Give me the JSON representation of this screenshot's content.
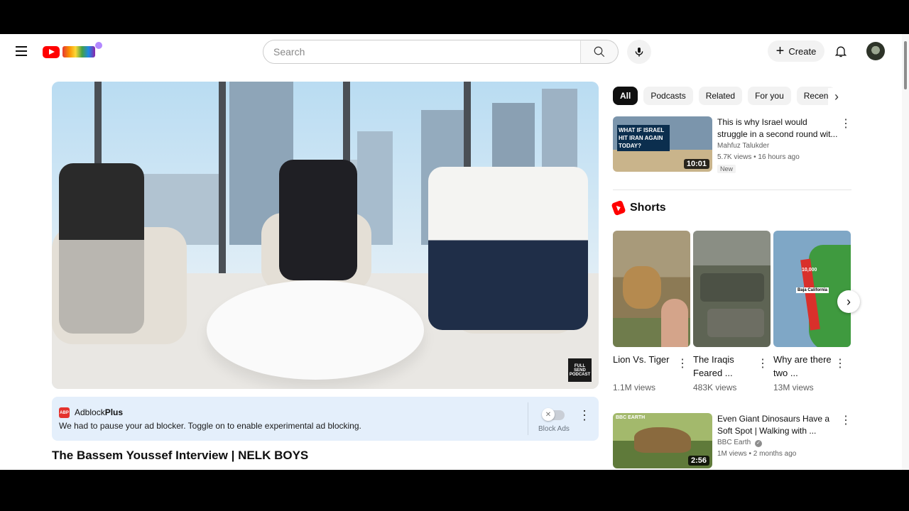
{
  "header": {
    "search_placeholder": "Search",
    "create_label": "Create"
  },
  "video": {
    "title": "The Bassem Youssef Interview | NELK BOYS",
    "watermark": "FULL SEND PODCAST"
  },
  "adblock": {
    "brand_prefix": "Adblock",
    "brand_suffix": "Plus",
    "logo_text": "ABP",
    "message": "We had to pause your ad blocker. Toggle on to enable experimental ad blocking.",
    "toggle_label": "Block Ads"
  },
  "chips": [
    "All",
    "Podcasts",
    "Related",
    "For you",
    "Recen"
  ],
  "recommendations": [
    {
      "title": "This is why Israel would struggle in a second round wit...",
      "channel": "Mahfuz Talukder",
      "meta": "5.7K views • 16 hours ago",
      "badge": "New",
      "duration": "10:01",
      "thumb_text": "WHAT IF ISRAEL HIT IRAN AGAIN TODAY?"
    },
    {
      "title": "Even Giant Dinosaurs Have a Soft Spot | Walking with ...",
      "channel": "BBC Earth",
      "meta": "1M views • 2 months ago",
      "duration": "2:56",
      "thumb_text": "BBC EARTH"
    }
  ],
  "shorts": {
    "heading": "Shorts",
    "items": [
      {
        "title": "Lion Vs. Tiger",
        "views": "1.1M views"
      },
      {
        "title": "The Iraqis Feared ...",
        "views": "483K views"
      },
      {
        "title": "Why are there two ...",
        "views": "13M views"
      }
    ],
    "map_label": "Baja California",
    "map_number": "10,000"
  },
  "colors": {
    "youtube_red": "#ff0000",
    "abp_bg": "#e4effb",
    "chip_active": "#0f0f0f"
  }
}
